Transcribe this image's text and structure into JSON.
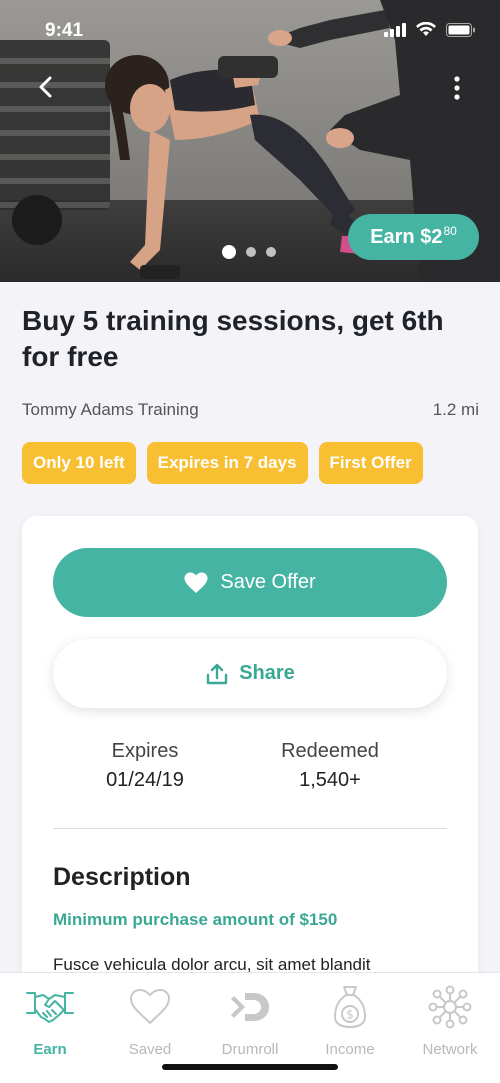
{
  "status_bar": {
    "time": "9:41"
  },
  "hero": {
    "earn_label": "Earn $2",
    "earn_cents": "80",
    "slide_count": 3,
    "active_slide": 1
  },
  "offer": {
    "title": "Buy 5 training sessions, get 6th for free",
    "merchant": "Tommy Adams Training",
    "distance": "1.2 mi",
    "tags": [
      "Only 10 left",
      "Expires in 7 days",
      "First Offer"
    ]
  },
  "actions": {
    "save_label": "Save Offer",
    "share_label": "Share"
  },
  "stats": {
    "expires_label": "Expires",
    "expires_value": "01/24/19",
    "redeemed_label": "Redeemed",
    "redeemed_value": "1,540+"
  },
  "description": {
    "heading": "Description",
    "minimum": "Minimum purchase amount of $150",
    "body": "Fusce vehicula dolor arcu, sit amet blandit"
  },
  "tabbar": {
    "items": [
      {
        "label": "Earn",
        "icon": "handshake-icon",
        "active": true
      },
      {
        "label": "Saved",
        "icon": "heart-icon",
        "active": false
      },
      {
        "label": "Drumroll",
        "icon": "drumroll-icon",
        "active": false
      },
      {
        "label": "Income",
        "icon": "money-bag-icon",
        "active": false
      },
      {
        "label": "Network",
        "icon": "network-icon",
        "active": false
      }
    ]
  },
  "colors": {
    "accent": "#46b4a2",
    "tag": "#f7bf31",
    "background": "#f4f4f8"
  }
}
